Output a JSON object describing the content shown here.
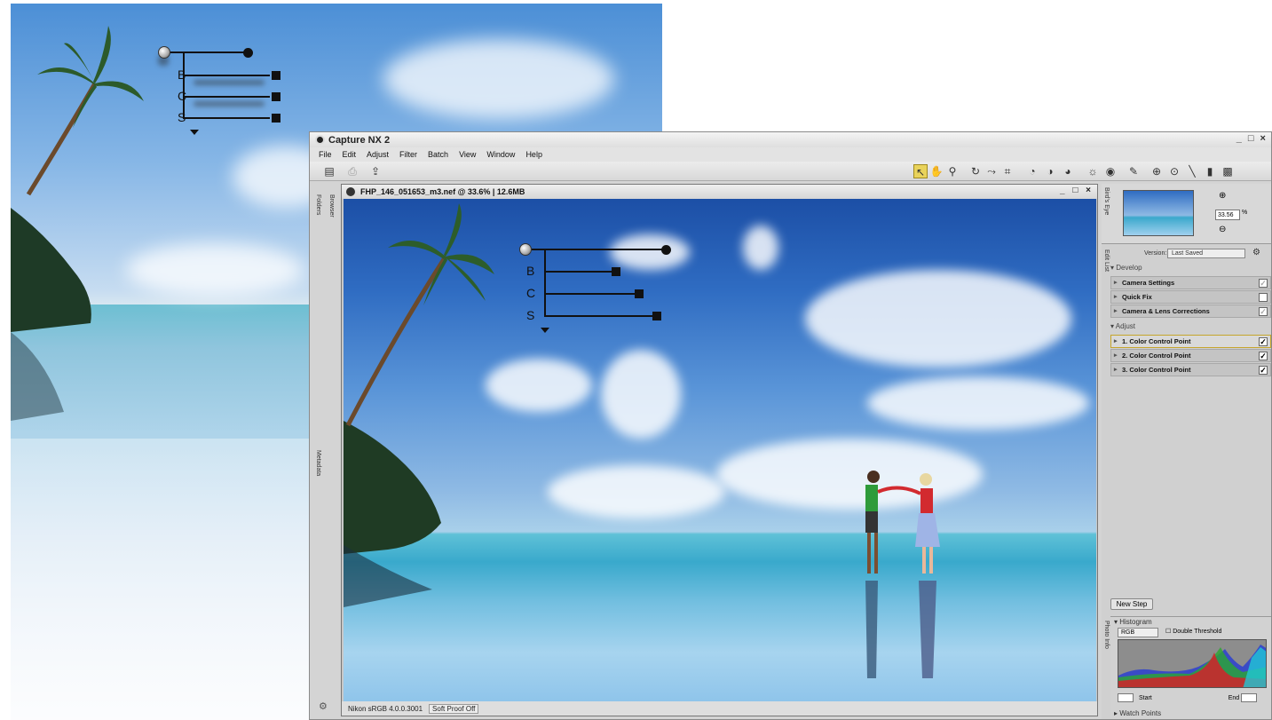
{
  "app": {
    "title": "Capture NX 2",
    "window_controls": "_ □ ×"
  },
  "menu": [
    "File",
    "Edit",
    "Adjust",
    "Filter",
    "Batch",
    "View",
    "Window",
    "Help"
  ],
  "side_tabs": {
    "folders": "Folders",
    "browser": "Browser",
    "metadata": "Metadata"
  },
  "document": {
    "title": "FHP_146_051653_m3.nef @ 33.6% | 12.6MB",
    "controls": "_ □ ×",
    "profile": "Nikon sRGB 4.0.0.3001",
    "soft_proof": "Soft Proof Off"
  },
  "control_point": {
    "labels": [
      "B",
      "C",
      "S"
    ]
  },
  "right_panel": {
    "birds_eye_tab": "Bird's Eye",
    "zoom_value": "33.56",
    "zoom_unit": "%",
    "edit_list_tab": "Edit List",
    "versions_label": "Version:",
    "versions_value": "Last Saved",
    "develop_header": "Develop",
    "develop_steps": [
      "Camera Settings",
      "Quick Fix",
      "Camera & Lens Corrections"
    ],
    "adjust_header": "Adjust",
    "adjust_steps": [
      "1. Color Control Point",
      "2. Color Control Point",
      "3. Color Control Point"
    ],
    "new_step": "New Step",
    "photo_info_tab": "Photo Info",
    "histogram_header": "Histogram",
    "histogram_channel": "RGB",
    "double_threshold": "Double Threshold",
    "start_label": "Start",
    "end_label": "End",
    "watch_points": "Watch Points"
  },
  "colors": {
    "selected_step_border": "#c5a52c",
    "active_tool": "#e9d35b"
  }
}
